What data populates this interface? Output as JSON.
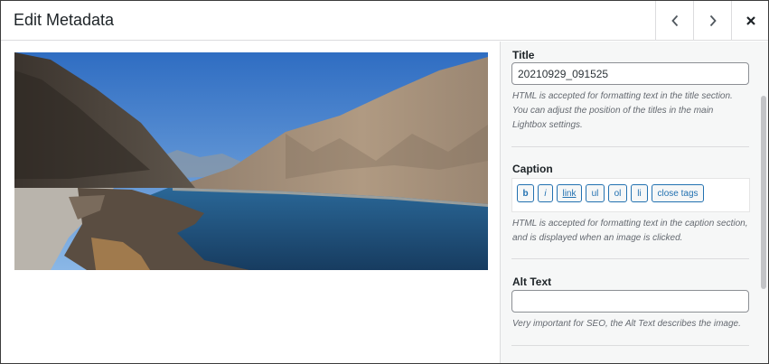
{
  "header": {
    "title": "Edit Metadata",
    "prev_icon": "chevron-left-icon",
    "next_icon": "chevron-right-icon",
    "close_icon": "close-icon"
  },
  "photo": {
    "sky_color": "#3a78c9",
    "water_color": "#1f4f7d",
    "mountain_color": "#a58d76"
  },
  "sidebar": {
    "title": {
      "label": "Title",
      "value": "20210929_091525",
      "help": "HTML is accepted for formatting text in the title section. You can adjust the position of the titles in the main Lightbox settings."
    },
    "caption": {
      "label": "Caption",
      "buttons": [
        "b",
        "i",
        "link",
        "ul",
        "ol",
        "li",
        "close tags"
      ],
      "value": "",
      "help": "HTML is accepted for formatting text in the caption section, and is displayed when an image is clicked."
    },
    "alt_text": {
      "label": "Alt Text",
      "value": "",
      "help": "Very important for SEO, the Alt Text describes the image."
    }
  },
  "colors": {
    "link_blue": "#2271b1",
    "border": "#dcdcde",
    "sidebar_bg": "#f6f7f7"
  }
}
